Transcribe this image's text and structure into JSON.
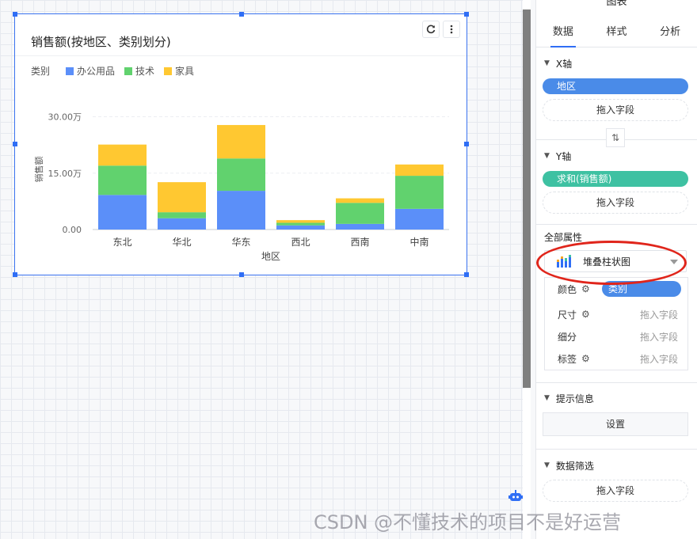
{
  "chart_widget": {
    "title": "销售额(按地区、类别划分)",
    "toolbar": {
      "refresh_icon": "refresh-icon",
      "more_icon": "more-vertical-icon"
    }
  },
  "chart_data": {
    "type": "bar",
    "stacked": true,
    "categories": [
      "东北",
      "华北",
      "华东",
      "西北",
      "西南",
      "中南"
    ],
    "legend_title": "类别",
    "series": [
      {
        "name": "办公用品",
        "color": "#5b8ff9",
        "values": [
          9.2,
          3.0,
          10.3,
          1.1,
          1.5,
          5.5
        ]
      },
      {
        "name": "技术",
        "color": "#61d26e",
        "values": [
          7.8,
          1.6,
          8.6,
          0.7,
          5.6,
          8.8
        ]
      },
      {
        "name": "家具",
        "color": "#ffc831",
        "values": [
          5.6,
          8.0,
          8.9,
          0.7,
          1.2,
          3.0
        ]
      }
    ],
    "y_ticks": [
      {
        "value": 0,
        "label": "0.00"
      },
      {
        "value": 15,
        "label": "15.00万"
      },
      {
        "value": 30,
        "label": "30.00万"
      }
    ],
    "ylim": [
      0,
      32
    ],
    "xlabel": "地区",
    "ylabel": "销售额",
    "grid": true,
    "legend_position": "top-left"
  },
  "panel": {
    "title": "图表",
    "tabs": [
      "数据",
      "样式",
      "分析"
    ],
    "x_axis": {
      "label": "X轴",
      "field": "地区",
      "field_color": "#4a8be8",
      "drop_hint": "拖入字段"
    },
    "swap_icon": "swap-vertical-icon",
    "y_axis": {
      "label": "Y轴",
      "field": "求和(销售额)",
      "field_color": "#3ec1a2",
      "drop_hint": "拖入字段"
    },
    "all_props": {
      "label": "全部属性",
      "chart_type": "堆叠柱状图",
      "rows": [
        {
          "label": "颜色",
          "value": "类别",
          "is_field": true
        },
        {
          "label": "尺寸",
          "value": "拖入字段",
          "is_field": false
        },
        {
          "label": "细分",
          "value": "拖入字段",
          "is_field": false
        },
        {
          "label": "标签",
          "value": "拖入字段",
          "is_field": false
        }
      ]
    },
    "tooltip": {
      "label": "提示信息",
      "button": "设置"
    },
    "filter": {
      "label": "数据筛选",
      "drop_hint": "拖入字段"
    }
  },
  "watermark": "CSDN @不懂技术的项目不是好运营"
}
